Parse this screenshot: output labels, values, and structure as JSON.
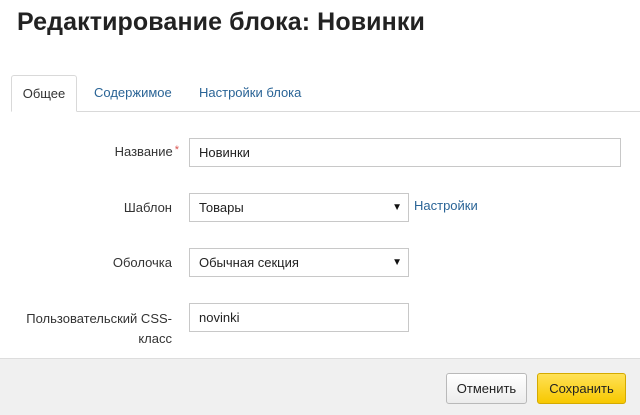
{
  "dialog": {
    "title": "Редактирование блока: Новинки"
  },
  "tabs": [
    {
      "label": "Общее",
      "active": true
    },
    {
      "label": "Содержимое",
      "active": false
    },
    {
      "label": "Настройки блока",
      "active": false
    }
  ],
  "form": {
    "name": {
      "label": "Название",
      "required_mark": "*",
      "value": "Новинки"
    },
    "template": {
      "label": "Шаблон",
      "value": "Товары",
      "settings_link": "Настройки"
    },
    "wrapper": {
      "label": "Оболочка",
      "value": "Обычная секция"
    },
    "css_class": {
      "label_line1": "Пользовательский CSS-",
      "label_line2": "класс",
      "value": "novinki"
    }
  },
  "footer": {
    "cancel_label": "Отменить",
    "save_label": "Сохранить"
  },
  "colors": {
    "link": "#2a6496",
    "save_button": "#f7c800",
    "required": "#d9534f"
  }
}
